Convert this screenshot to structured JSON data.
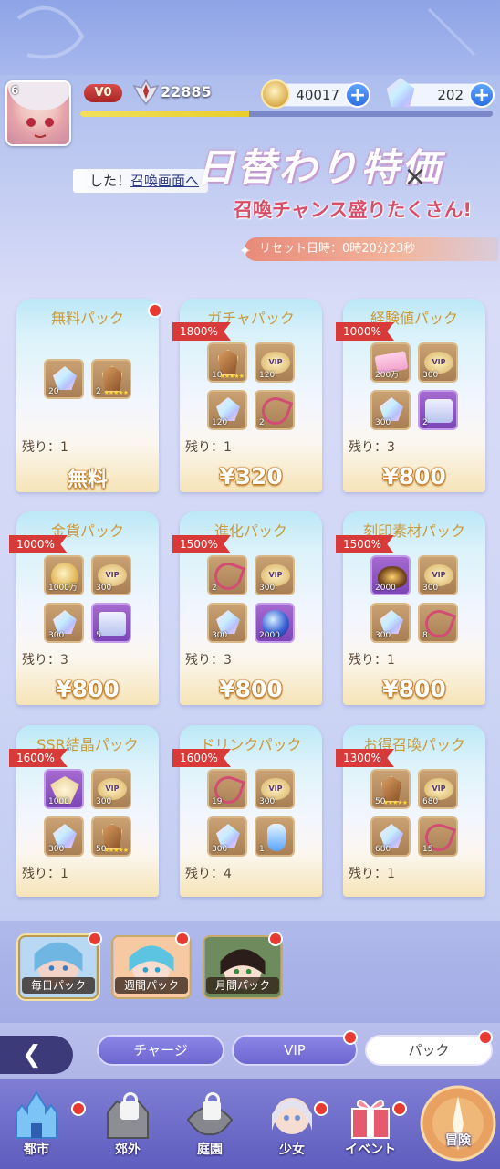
{
  "hud": {
    "level": "6",
    "vip": "V0",
    "power": "22885",
    "gold": "40017",
    "gems": "202",
    "exp_fraction": 0.41
  },
  "banner": {
    "title": "日替わり特価",
    "subtitle": "召喚チャンス盛りたくさん!",
    "ticker_prefix": "した！",
    "ticker_link": "召喚画面へ",
    "reset": "リセット日時：0時20分23秒"
  },
  "packs": [
    {
      "name": "無料パック",
      "badge": "",
      "remain": "残り：1",
      "price": "無料",
      "items": [
        {
          "icon": "crystal-icon",
          "qty": "20"
        },
        {
          "icon": "shard-icon",
          "qty": "2",
          "stars": "★★★★★"
        }
      ]
    },
    {
      "name": "ガチャパック",
      "badge": "1800%",
      "remain": "残り：1",
      "price": "¥320",
      "items": [
        {
          "icon": "shard-icon",
          "qty": "10",
          "stars": "★★★★★"
        },
        {
          "icon": "vip-icon",
          "qty": "120"
        },
        {
          "icon": "crystal-icon",
          "qty": "120"
        },
        {
          "icon": "key-icon",
          "qty": "2"
        }
      ]
    },
    {
      "name": "経験値パック",
      "badge": "1000%",
      "remain": "残り：3",
      "price": "¥800",
      "items": [
        {
          "icon": "ticket-icon",
          "qty": "200万"
        },
        {
          "icon": "vip-icon",
          "qty": "300"
        },
        {
          "icon": "crystal-icon",
          "qty": "300"
        },
        {
          "icon": "chest-icon",
          "qty": "2",
          "purple": true
        }
      ]
    },
    {
      "name": "金貨パック",
      "badge": "1000%",
      "remain": "残り：3",
      "price": "¥800",
      "items": [
        {
          "icon": "gold-icon",
          "qty": "1000万"
        },
        {
          "icon": "vip-icon",
          "qty": "300"
        },
        {
          "icon": "crystal-icon",
          "qty": "300"
        },
        {
          "icon": "chest-icon",
          "qty": "5",
          "purple": true
        }
      ]
    },
    {
      "name": "進化パック",
      "badge": "1500%",
      "remain": "残り：3",
      "price": "¥800",
      "items": [
        {
          "icon": "key-icon",
          "qty": "2"
        },
        {
          "icon": "vip-icon",
          "qty": "300"
        },
        {
          "icon": "crystal-icon",
          "qty": "300"
        },
        {
          "icon": "orb-icon",
          "qty": "2000",
          "purple": true
        }
      ]
    },
    {
      "name": "刻印素材パック",
      "badge": "1500%",
      "remain": "残り：1",
      "price": "¥800",
      "items": [
        {
          "icon": "bag-icon",
          "qty": "2000",
          "purple": true
        },
        {
          "icon": "vip-icon",
          "qty": "300"
        },
        {
          "icon": "crystal-icon",
          "qty": "300"
        },
        {
          "icon": "key-icon",
          "qty": "8"
        }
      ]
    },
    {
      "name": "SSR結晶パック",
      "badge": "1600%",
      "remain": "残り：1",
      "price": "",
      "items": [
        {
          "icon": "wing-icon",
          "qty": "1000",
          "purple": true
        },
        {
          "icon": "vip-icon",
          "qty": "300"
        },
        {
          "icon": "crystal-icon",
          "qty": "300"
        },
        {
          "icon": "shard-icon",
          "qty": "50",
          "stars": "★★★★★"
        }
      ]
    },
    {
      "name": "ドリンクパック",
      "badge": "1600%",
      "remain": "残り：4",
      "price": "",
      "items": [
        {
          "icon": "key-icon",
          "qty": "19"
        },
        {
          "icon": "vip-icon",
          "qty": "300"
        },
        {
          "icon": "crystal-icon",
          "qty": "300"
        },
        {
          "icon": "potion-icon",
          "qty": "1"
        }
      ]
    },
    {
      "name": "お得召喚パック",
      "badge": "1300%",
      "remain": "残り：1",
      "price": "",
      "items": [
        {
          "icon": "shard-icon",
          "qty": "50",
          "stars": "★★★★★"
        },
        {
          "icon": "vip-icon",
          "qty": "680"
        },
        {
          "icon": "crystal-icon",
          "qty": "680"
        },
        {
          "icon": "key-icon",
          "qty": "15"
        }
      ]
    }
  ],
  "pack_tabs": [
    {
      "label": "毎日パック"
    },
    {
      "label": "週間パック"
    },
    {
      "label": "月間パック"
    }
  ],
  "store_tabs": {
    "charge": "チャージ",
    "vip": "VIP",
    "pack": "パック"
  },
  "nav": [
    {
      "label": "都市"
    },
    {
      "label": "郊外"
    },
    {
      "label": "庭園"
    },
    {
      "label": "少女"
    },
    {
      "label": "イベント"
    },
    {
      "label": "冒険"
    }
  ],
  "colors": {
    "badge": "#d83a3a",
    "price_outline": "#b96f1b",
    "nav_bg": "#6d69c8",
    "accent_plus": "#2d6fe0"
  }
}
